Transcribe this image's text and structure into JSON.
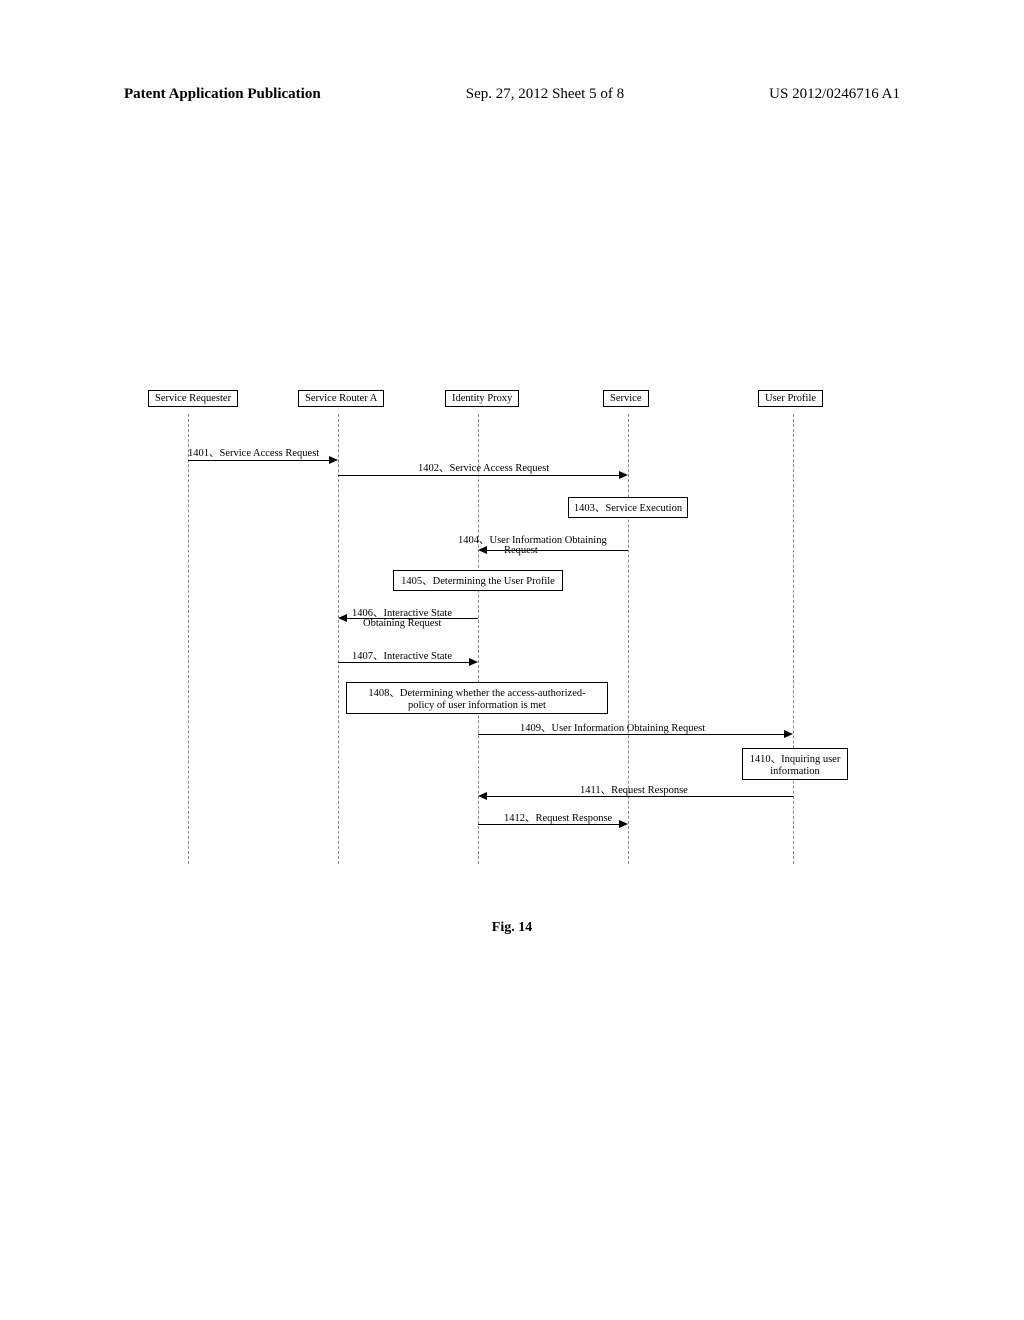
{
  "header": {
    "left": "Patent Application Publication",
    "center": "Sep. 27, 2012  Sheet 5 of 8",
    "right": "US 2012/0246716 A1"
  },
  "participants": {
    "p1": "Service Requester",
    "p2": "Service Router A",
    "p3": "Identity Proxy",
    "p4": "Service",
    "p5": "User Profile"
  },
  "messages": {
    "m1401": "1401、Service Access Request",
    "m1402": "1402、Service Access Request",
    "m1403": "1403、Service Execution",
    "m1404_a": "1404、User Information Obtaining",
    "m1404_b": "Request",
    "m1405": "1405、Determining the User Profile",
    "m1406_a": "1406、Interactive State",
    "m1406_b": "Obtaining Request",
    "m1407": "1407、Interactive State",
    "m1408_a": "1408、Determining whether the access-authorized-",
    "m1408_b": "policy of user information is met",
    "m1409": "1409、User Information Obtaining Request",
    "m1410_a": "1410、Inquiring user",
    "m1410_b": "information",
    "m1411": "1411、Request Response",
    "m1412": "1412、Request Response"
  },
  "figure_caption": "Fig. 14"
}
